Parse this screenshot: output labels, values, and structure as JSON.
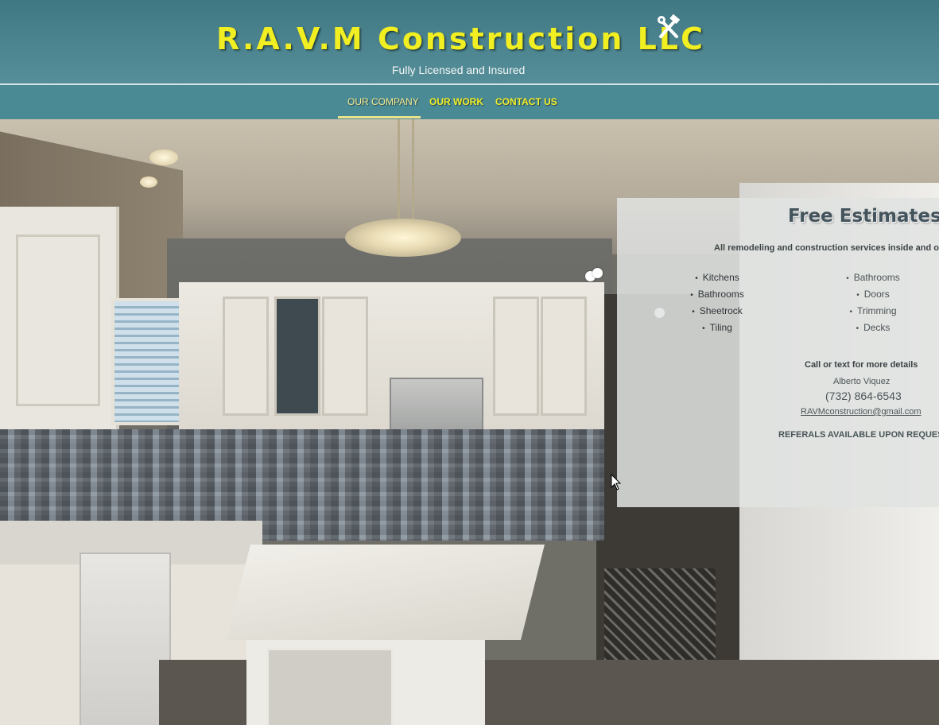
{
  "header": {
    "brand_name": "R.A.V.M Construction LLC",
    "tagline": "Fully Licensed and Insured",
    "brand_color": "#f1ee22",
    "background_color": "#4a8a94",
    "logo_icon": "hammer-wrench-icon"
  },
  "nav": {
    "items": [
      {
        "label": "OUR COMPANY",
        "active": true
      },
      {
        "label": "OUR WORK",
        "active": false
      },
      {
        "label": "CONTACT US",
        "active": false
      }
    ]
  },
  "hero": {
    "image": "kitchen-remodel-photo"
  },
  "estimate_panel": {
    "title": "Free Estimates",
    "subtitle": "All remodeling and construction services inside and o",
    "services_left": [
      "Kitchens",
      "Bathrooms",
      "Sheetrock",
      "Tiling"
    ],
    "services_right": [
      "Bathrooms",
      "Doors",
      "Trimming",
      "Decks"
    ],
    "call_text": "Call or text for more details",
    "contact_name": "Alberto Viquez",
    "phone": "(732) 864-6543",
    "email": "RAVMconstruction@gmail.com",
    "referrals": "REFERALS AVAILABLE UPON REQUES"
  },
  "slider": {
    "dot_count": 3
  }
}
